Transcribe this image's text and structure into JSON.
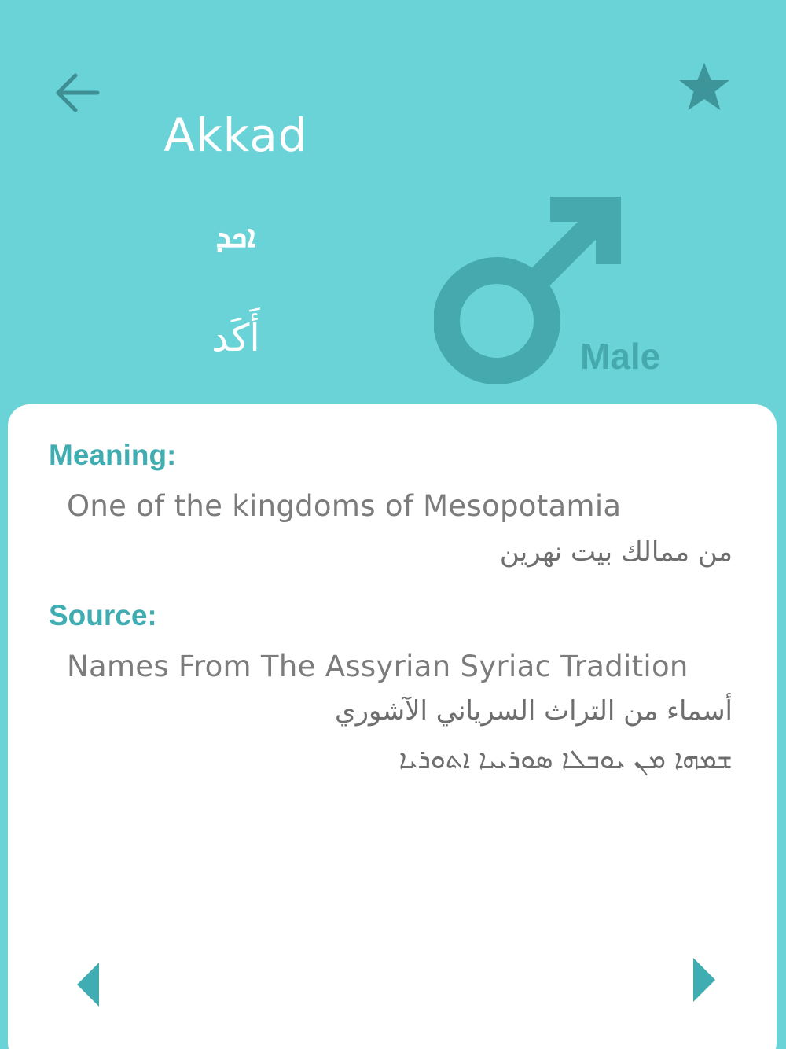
{
  "header": {
    "back_icon": "arrow-left-icon",
    "favorite_icon": "star-icon",
    "name_latin": "Akkad",
    "name_syriac": "ܐܟܕ",
    "name_arabic": "أَكَد",
    "gender_icon": "male-symbol-icon",
    "gender_label": "Male"
  },
  "details": {
    "meaning_label": "Meaning:",
    "meaning_en": "One of the kingdoms of Mesopotamia",
    "meaning_ar": "من ممالك بيت نهرين",
    "source_label": "Source:",
    "source_en": "Names From The Assyrian Syriac Tradition",
    "source_ar": "أسماء من التراث السرياني الآشوري",
    "source_syr": "ܫܡܗܐ ܡܢ ܝܘܒܠܐ ܣܘܪܝܝܐ ܐܬܘܪܝܐ"
  },
  "navigation": {
    "prev_icon": "triangle-left-icon",
    "next_icon": "triangle-right-icon"
  },
  "colors": {
    "background": "#69d3d7",
    "accent": "#3fadb1",
    "icon_dark": "#45a9ad"
  }
}
